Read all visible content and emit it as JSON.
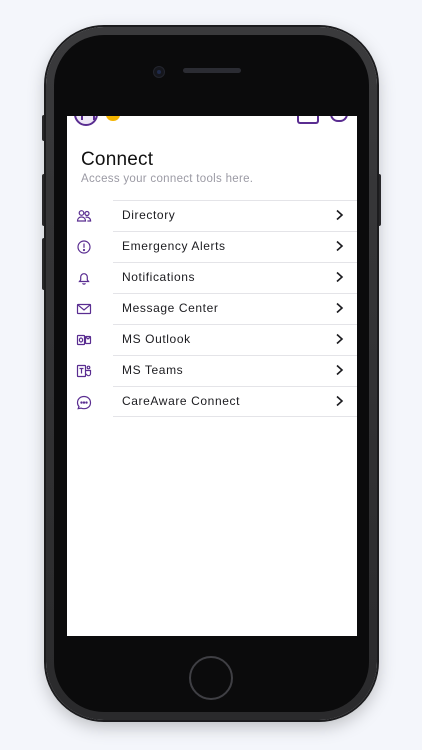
{
  "header": {
    "title": "Connect",
    "subtitle": "Access your connect tools here."
  },
  "top_bar": {
    "left_icons": [
      "avatar",
      "status-dot"
    ],
    "right_icons": [
      "calendar-icon",
      "bell-icon"
    ]
  },
  "menu": {
    "items": [
      {
        "label": "Directory",
        "icon": "people-icon"
      },
      {
        "label": "Emergency Alerts",
        "icon": "alert-circle-icon"
      },
      {
        "label": "Notifications",
        "icon": "bell-icon"
      },
      {
        "label": "Message Center",
        "icon": "envelope-icon"
      },
      {
        "label": "MS Outlook",
        "icon": "ms-outlook-icon"
      },
      {
        "label": "MS Teams",
        "icon": "ms-teams-icon"
      },
      {
        "label": "CareAware Connect",
        "icon": "chat-bubble-icon"
      }
    ]
  },
  "colors": {
    "accent": "#5a2d91",
    "status_dot": "#f4b400",
    "text_primary": "#111111",
    "text_secondary": "#9b9aa4",
    "divider": "#e4e4e8"
  }
}
